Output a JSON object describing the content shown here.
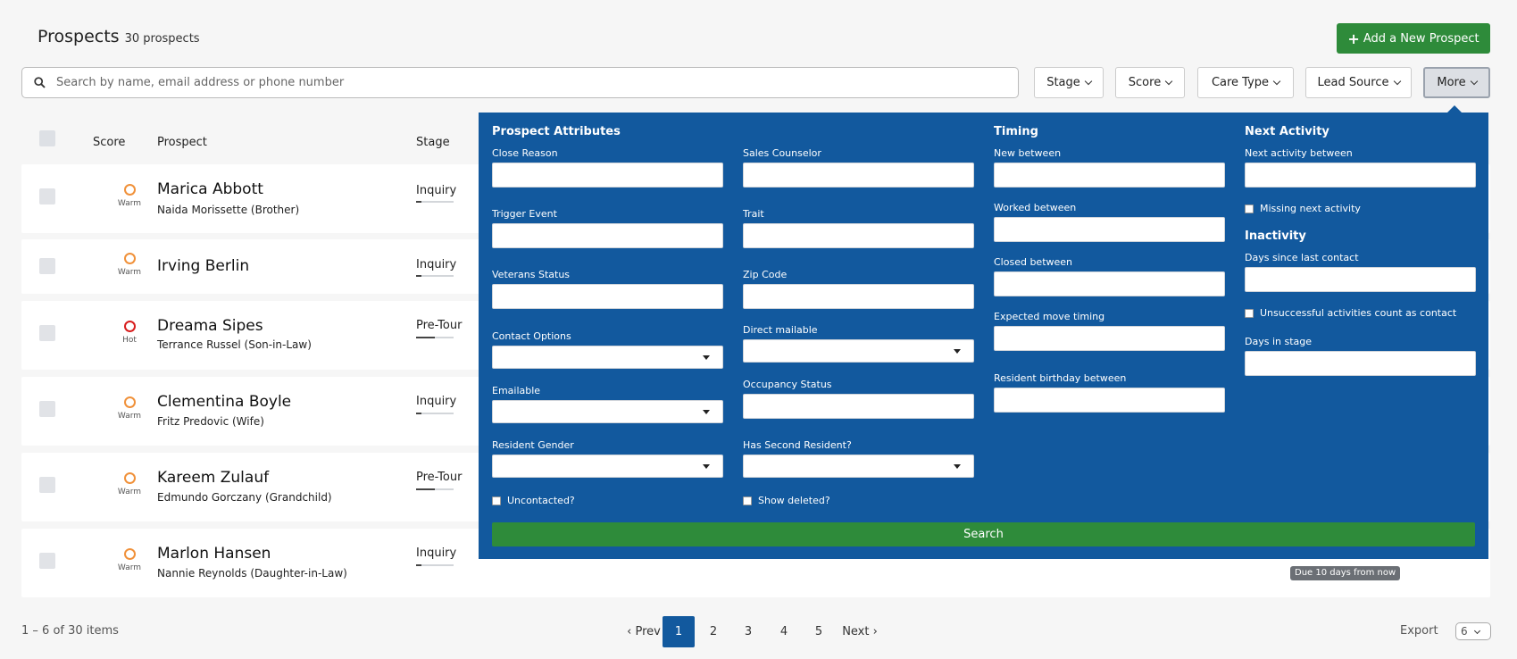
{
  "header": {
    "title": "Prospects",
    "count": "30 prospects",
    "add_button": "Add a New Prospect",
    "add_icon": "plus-icon"
  },
  "search": {
    "placeholder": "Search by name, email address or phone number",
    "icon": "search-icon"
  },
  "filters": [
    {
      "label": "Stage"
    },
    {
      "label": "Score"
    },
    {
      "label": "Care Type"
    },
    {
      "label": "Lead Source"
    },
    {
      "label": "More",
      "active": true
    }
  ],
  "table": {
    "columns": {
      "score": "Score",
      "prospect": "Prospect",
      "stage": "Stage"
    },
    "rows": [
      {
        "name": "Marica Abbott",
        "contact": "Naida Morissette (Brother)",
        "score": "Warm",
        "stage": "Inquiry",
        "stage_progress": 0.15
      },
      {
        "name": "Irving Berlin",
        "contact": "",
        "score": "Warm",
        "stage": "Inquiry",
        "stage_progress": 0.15
      },
      {
        "name": "Dreama Sipes",
        "contact": "Terrance Russel (Son-in-Law)",
        "score": "Hot",
        "stage": "Pre-Tour",
        "stage_progress": 0.5
      },
      {
        "name": "Clementina Boyle",
        "contact": "Fritz Predovic (Wife)",
        "score": "Warm",
        "stage": "Inquiry",
        "stage_progress": 0.15
      },
      {
        "name": "Kareem Zulauf",
        "contact": "Edmundo Gorczany (Grandchild)",
        "score": "Warm",
        "stage": "Pre-Tour",
        "stage_progress": 0.5
      },
      {
        "name": "Marlon Hansen",
        "contact": "Nannie Reynolds (Daughter-in-Law)",
        "score": "Warm",
        "stage": "Inquiry",
        "stage_progress": 0.15
      }
    ],
    "due_badge": "Due 10 days from now"
  },
  "panel": {
    "attributes_heading": "Prospect Attributes",
    "close_reason": "Close Reason",
    "sales_counselor": "Sales Counselor",
    "trigger_event": "Trigger Event",
    "trait": "Trait",
    "veterans_status": "Veterans Status",
    "zip_code": "Zip Code",
    "contact_options": "Contact Options",
    "direct_mailable": "Direct mailable",
    "emailable": "Emailable",
    "occupancy_status": "Occupancy Status",
    "resident_gender": "Resident Gender",
    "has_second_resident": "Has Second Resident?",
    "uncontacted": "Uncontacted?",
    "show_deleted": "Show deleted?",
    "timing_heading": "Timing",
    "new_between": "New between",
    "worked_between": "Worked between",
    "closed_between": "Closed between",
    "expected_move_timing": "Expected move timing",
    "resident_birthday_between": "Resident birthday between",
    "next_activity_heading": "Next Activity",
    "next_activity_between": "Next activity between",
    "missing_next_activity": "Missing next activity",
    "inactivity_heading": "Inactivity",
    "days_since_last_contact": "Days since last contact",
    "unsuccessful_activities": "Unsuccessful activities count as contact",
    "days_in_stage": "Days in stage",
    "search_button": "Search"
  },
  "footer": {
    "count": "1 – 6 of 30 items",
    "prev": "‹ Prev",
    "pages": [
      "1",
      "2",
      "3",
      "4",
      "5"
    ],
    "current_page": "1",
    "next": "Next ›",
    "export": "Export",
    "per_page": "6"
  },
  "colors": {
    "primary": "#12599e",
    "success": "#2e8b3a",
    "warm": "#f0913a",
    "hot": "#d81e1e"
  }
}
